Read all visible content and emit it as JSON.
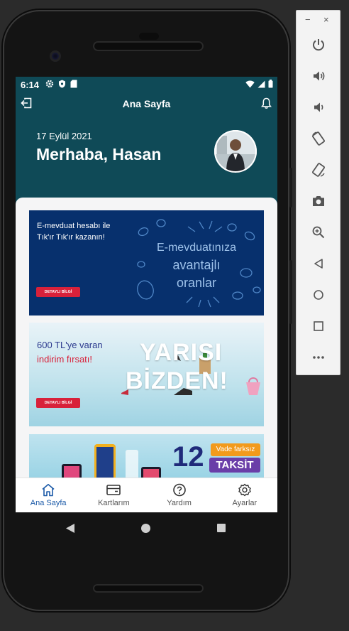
{
  "status_bar": {
    "time": "6:14"
  },
  "app_bar": {
    "title": "Ana Sayfa"
  },
  "greeting": {
    "date": "17 Eylül 2021",
    "name": "Merhaba, Hasan"
  },
  "banners": [
    {
      "line1": "E-mevduat hesabı ile",
      "line2": "Tık'ır Tık'ır kazanın!",
      "headline1": "E-mevduatınıza",
      "headline2": "avantajlı",
      "headline3": "oranlar",
      "button": "DETAYLI BİLGİ"
    },
    {
      "line1": "600 TL'ye varan",
      "line2": "indirim fırsatı!",
      "headline1": "YARISI",
      "headline2": "BİZDEN!",
      "button": "DETAYLI BİLGİ"
    },
    {
      "number": "12",
      "tag": "Vade farksız",
      "label": "TAKSİT"
    }
  ],
  "bottom_nav": [
    {
      "label": "Ana Sayfa",
      "icon": "home-icon"
    },
    {
      "label": "Kartlarım",
      "icon": "card-icon"
    },
    {
      "label": "Yardım",
      "icon": "help-icon"
    },
    {
      "label": "Ayarlar",
      "icon": "settings-icon"
    }
  ],
  "colors": {
    "header_bg": "#0f4a57",
    "nav_active": "#1b5aa8",
    "banner1_bg": "#07306d",
    "button_red": "#d8213a"
  }
}
